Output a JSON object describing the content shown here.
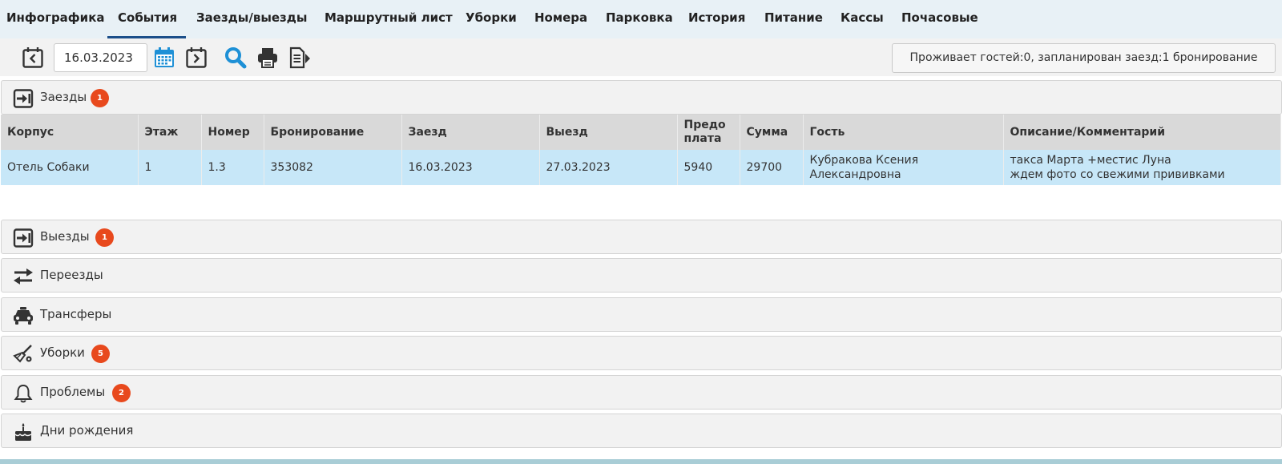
{
  "nav": {
    "tabs": [
      {
        "label": "Инфографика",
        "active": false
      },
      {
        "label": "События",
        "active": true
      },
      {
        "label": "Заезды/выезды",
        "active": false
      },
      {
        "label": "Маршрутный лист",
        "active": false
      },
      {
        "label": "Уборки",
        "active": false
      },
      {
        "label": "Номера",
        "active": false
      },
      {
        "label": "Парковка",
        "active": false
      },
      {
        "label": "История",
        "active": false
      },
      {
        "label": "Питание",
        "active": false
      },
      {
        "label": "Кассы",
        "active": false
      },
      {
        "label": "Почасовые",
        "active": false
      }
    ]
  },
  "toolbar": {
    "date_value": "16.03.2023",
    "status_text": "Проживает гостей:0, запланирован заезд:1 бронирование",
    "accent_color": "#1e90d6"
  },
  "arrivals": {
    "label": "Заезды",
    "badge": "1",
    "columns": [
      "Корпус",
      "Этаж",
      "Номер",
      "Бронирование",
      "Заезд",
      "Выезд",
      "Предо плата",
      "Сумма",
      "Гость",
      "Описание/Комментарий"
    ],
    "rows": [
      {
        "building": "Отель Собаки",
        "floor": "1",
        "room": "1.3",
        "booking": "353082",
        "arrival": "16.03.2023",
        "departure": "27.03.2023",
        "prepayment": "5940",
        "sum": "29700",
        "guest": "Кубракова Ксения Александровна",
        "comment_line1": "такса Марта +местис Луна",
        "comment_line2": "ждем фото со свежими прививками"
      }
    ]
  },
  "sections": [
    {
      "label": "Выезды",
      "badge": "1",
      "icon": "logout-icon"
    },
    {
      "label": "Переезды",
      "badge": "",
      "icon": "swap-arrows-icon"
    },
    {
      "label": "Трансферы",
      "badge": "",
      "icon": "taxi-icon"
    },
    {
      "label": "Уборки",
      "badge": "5",
      "icon": "broom-icon"
    },
    {
      "label": "Проблемы",
      "badge": "2",
      "icon": "bell-icon"
    },
    {
      "label": "Дни рождения",
      "badge": "",
      "icon": "cake-icon"
    }
  ],
  "badge_color": "#e8491d"
}
